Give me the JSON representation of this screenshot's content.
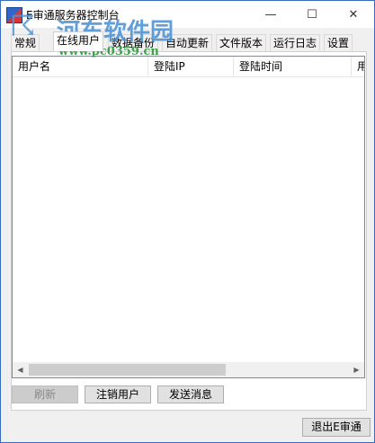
{
  "window": {
    "title": "E审通服务器控制台",
    "min_glyph": "—",
    "max_glyph": "☐",
    "close_glyph": "✕"
  },
  "watermark": {
    "logo_glyph": "☈",
    "title": "河东软件园",
    "url": "www.pc0359.cn"
  },
  "tabs": [
    {
      "label": "常规"
    },
    {
      "label": "在线用户",
      "active": true
    },
    {
      "label": "数据备份"
    },
    {
      "label": "自动更新"
    },
    {
      "label": "文件版本"
    },
    {
      "label": "运行日志"
    },
    {
      "label": "设置"
    }
  ],
  "list": {
    "columns": [
      "用户名",
      "登陆IP",
      "登陆时间",
      "用"
    ],
    "rows": []
  },
  "buttons": {
    "refresh": "刷新",
    "logout": "注销用户",
    "send": "发送消息",
    "exit": "退出E审通"
  },
  "scroll_icons": {
    "left": "◀",
    "right": "▶"
  }
}
